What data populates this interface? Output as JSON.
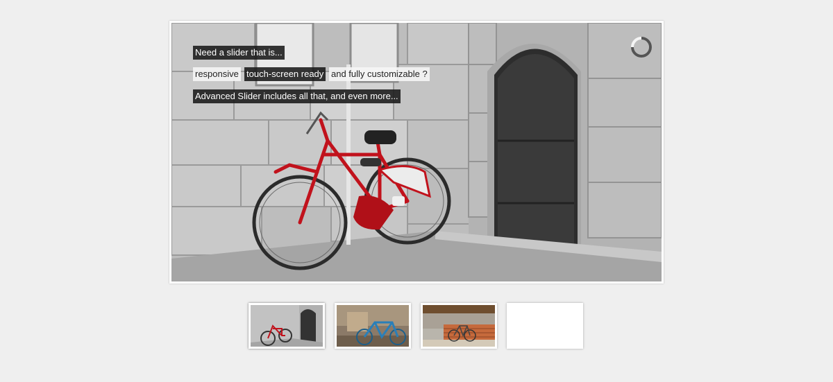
{
  "slider": {
    "captions": [
      {
        "text": "Need a slider that is..."
      },
      {
        "text": "responsive"
      },
      {
        "text": "touch-screen ready"
      },
      {
        "text": "and fully customizable ?"
      },
      {
        "text": "Advanced Slider includes all that, and even more..."
      }
    ],
    "timer_icon": "circular-timer-icon"
  },
  "thumbnails": [
    {
      "name": "thumbnail-red-bicycle",
      "selected": true
    },
    {
      "name": "thumbnail-blue-bicycle",
      "selected": false
    },
    {
      "name": "thumbnail-bicycle-brick-wall",
      "selected": false
    },
    {
      "name": "thumbnail-blank",
      "selected": false
    }
  ],
  "colors": {
    "page_background": "#efefef",
    "caption_dark": "#191919",
    "caption_light": "#f5f5f5",
    "bike_red": "#c1121c",
    "bike_blue": "#2a7fb8"
  }
}
